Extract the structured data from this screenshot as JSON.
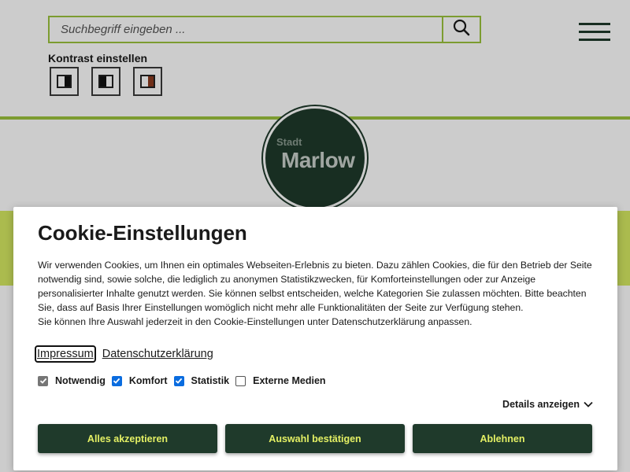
{
  "header": {
    "search": {
      "placeholder": "Suchbegriff eingeben ..."
    },
    "contrast": {
      "label": "Kontrast einstellen",
      "options": [
        {
          "left": "#ffffff",
          "right": "#111111"
        },
        {
          "left": "#111111",
          "right": "#ffffff"
        },
        {
          "left": "#ffffff",
          "right": "#8b3a1e"
        }
      ]
    },
    "logo": {
      "line1": "Stadt",
      "line2": "Marlow"
    }
  },
  "colors": {
    "brand_dark": "#1f3a2b",
    "accent_green": "#9bc33c",
    "accent_yellow": "#e4f064",
    "band": "#d6ea62",
    "checkbox_blue": "#0a6cdf"
  },
  "cookie": {
    "title": "Cookie-Einstellungen",
    "paragraph1": "Wir verwenden Cookies, um Ihnen ein optimales Webseiten-Erlebnis zu bieten. Dazu zählen Cookies, die für den Betrieb der Seite notwendig sind, sowie solche, die lediglich zu anonymen Statistikzwecken, für Komforteinstellungen oder zur Anzeige personalisierter Inhalte genutzt werden. Sie können selbst entscheiden, welche Kategorien Sie zulassen möchten. Bitte beachten Sie, dass auf Basis Ihrer Einstellungen womöglich nicht mehr alle Funktionalitäten der Seite zur Verfügung stehen.",
    "paragraph2": "Sie können Ihre Auswahl jederzeit in den Cookie-Einstellungen unter Datenschutzerklärung anpassen.",
    "links": {
      "impressum": "Impressum",
      "datenschutz": "Datenschutzerklärung"
    },
    "options": [
      {
        "label": "Notwendig",
        "checked": true,
        "disabled": true
      },
      {
        "label": "Komfort",
        "checked": true,
        "disabled": false
      },
      {
        "label": "Statistik",
        "checked": true,
        "disabled": false
      },
      {
        "label": "Externe Medien",
        "checked": false,
        "disabled": false
      }
    ],
    "details_label": "Details anzeigen",
    "buttons": {
      "accept_all": "Alles akzeptieren",
      "confirm": "Auswahl bestätigen",
      "decline": "Ablehnen"
    }
  }
}
